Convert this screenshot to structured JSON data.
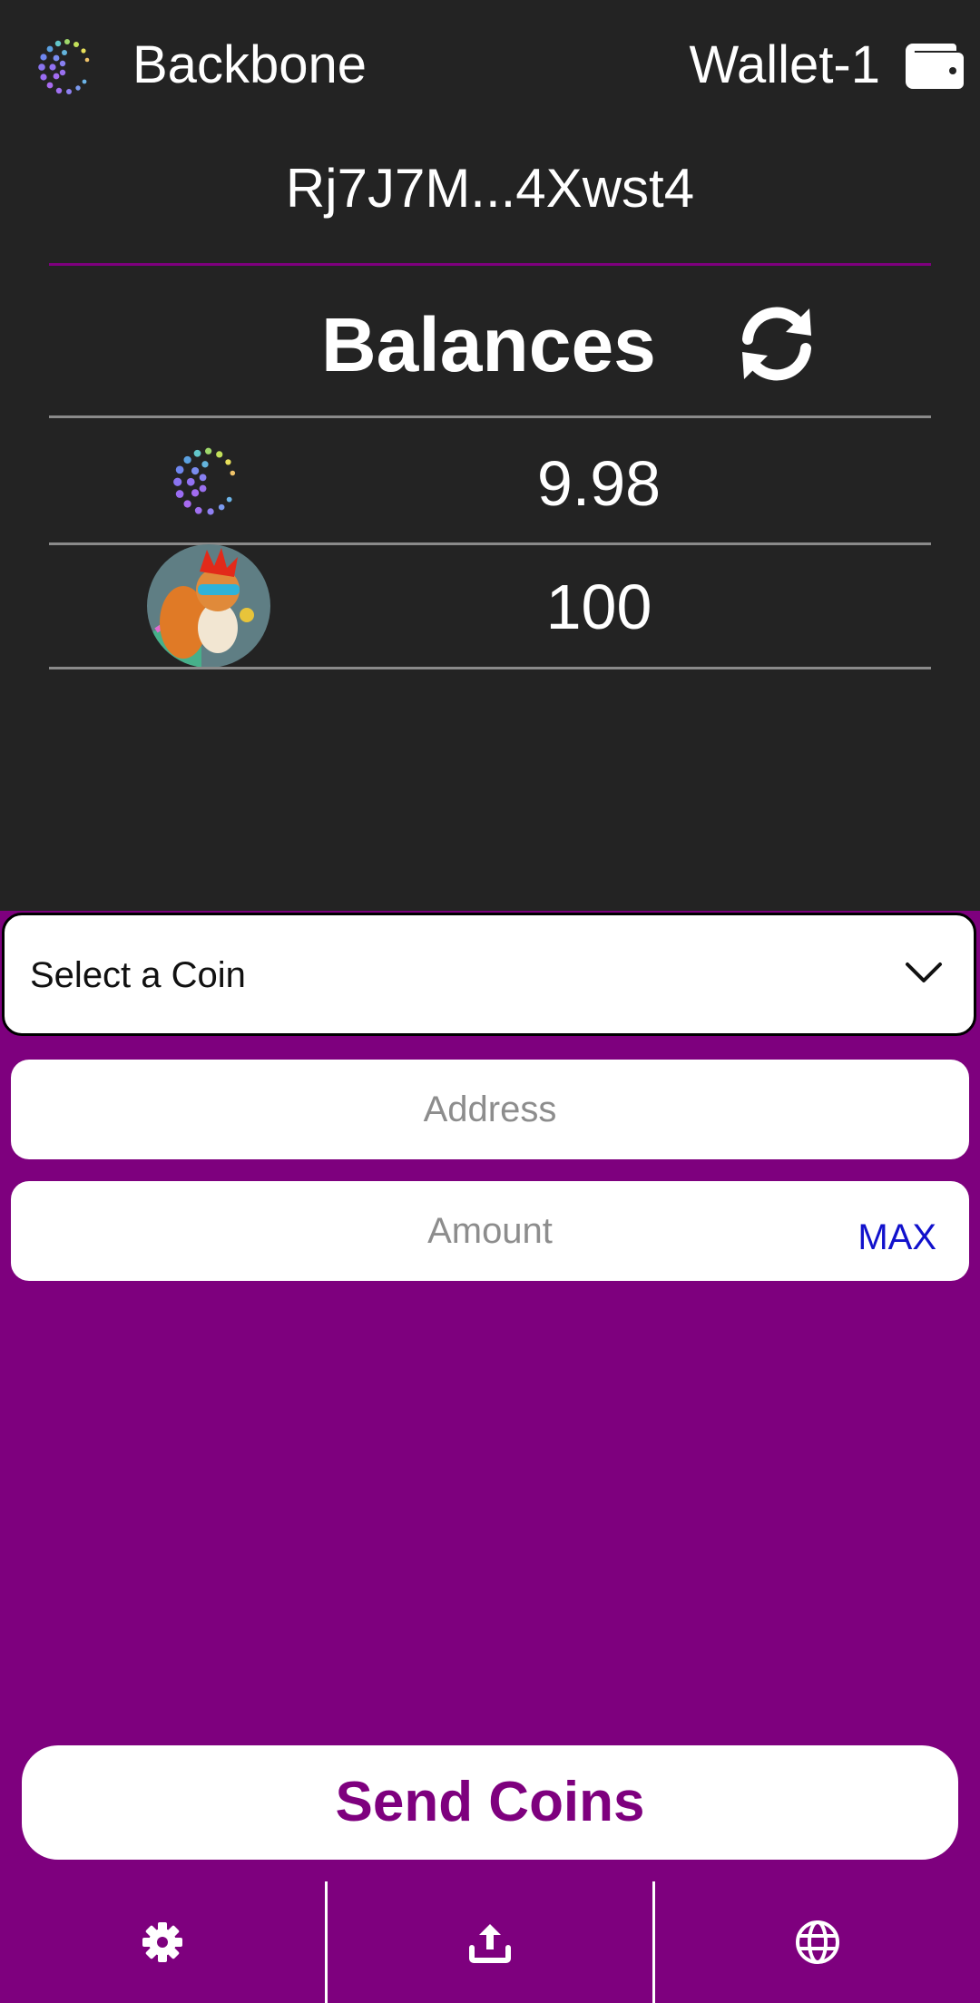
{
  "header": {
    "app_name": "Backbone",
    "wallet_name": "Wallet-1",
    "app_logo_icon": "dotted-spiral-logo-icon",
    "wallet_icon": "wallet-icon"
  },
  "account": {
    "address": "Rj7J7M...4Xwst4"
  },
  "balances": {
    "title": "Balances",
    "refresh_icon": "refresh-icon",
    "rows": [
      {
        "icon": "dotted-spiral-coin-icon",
        "value": "9.98"
      },
      {
        "icon": "squirrel-token-avatar",
        "value": "100"
      }
    ]
  },
  "send_form": {
    "coin_select_label": "Select a Coin",
    "address_placeholder": "Address",
    "amount_placeholder": "Amount",
    "max_label": "MAX",
    "send_label": "Send Coins"
  },
  "bottom_nav": {
    "items": [
      {
        "icon": "gear-icon"
      },
      {
        "icon": "upload-icon"
      },
      {
        "icon": "globe-icon"
      }
    ]
  },
  "colors": {
    "top_background": "#232323",
    "accent_purple": "#7e007e",
    "max_link": "#1111cc"
  }
}
